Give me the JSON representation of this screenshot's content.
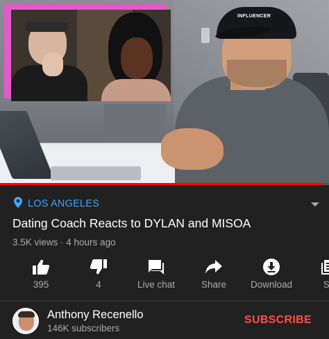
{
  "video": {
    "cap_text": "INFLUENCER",
    "progress_fraction": 0.98,
    "accent_color": "#e25bc9"
  },
  "location": {
    "text": "LOS ANGELES",
    "icon": "location-pin-icon",
    "color": "#3ea6ff"
  },
  "title": "Dating Coach Reacts to DYLAN and MISOA",
  "meta": "3.5K views · 4 hours ago",
  "actions": [
    {
      "icon": "thumbs-up-icon",
      "label": "395"
    },
    {
      "icon": "thumbs-down-icon",
      "label": "4"
    },
    {
      "icon": "live-chat-icon",
      "label": "Live chat"
    },
    {
      "icon": "share-icon",
      "label": "Share"
    },
    {
      "icon": "download-icon",
      "label": "Download"
    },
    {
      "icon": "save-icon",
      "label": "Sa"
    }
  ],
  "channel": {
    "name": "Anthony Recenello",
    "subscribers": "146K subscribers",
    "subscribe_label": "SUBSCRIBE",
    "subscribe_color": "#ff4e45"
  }
}
